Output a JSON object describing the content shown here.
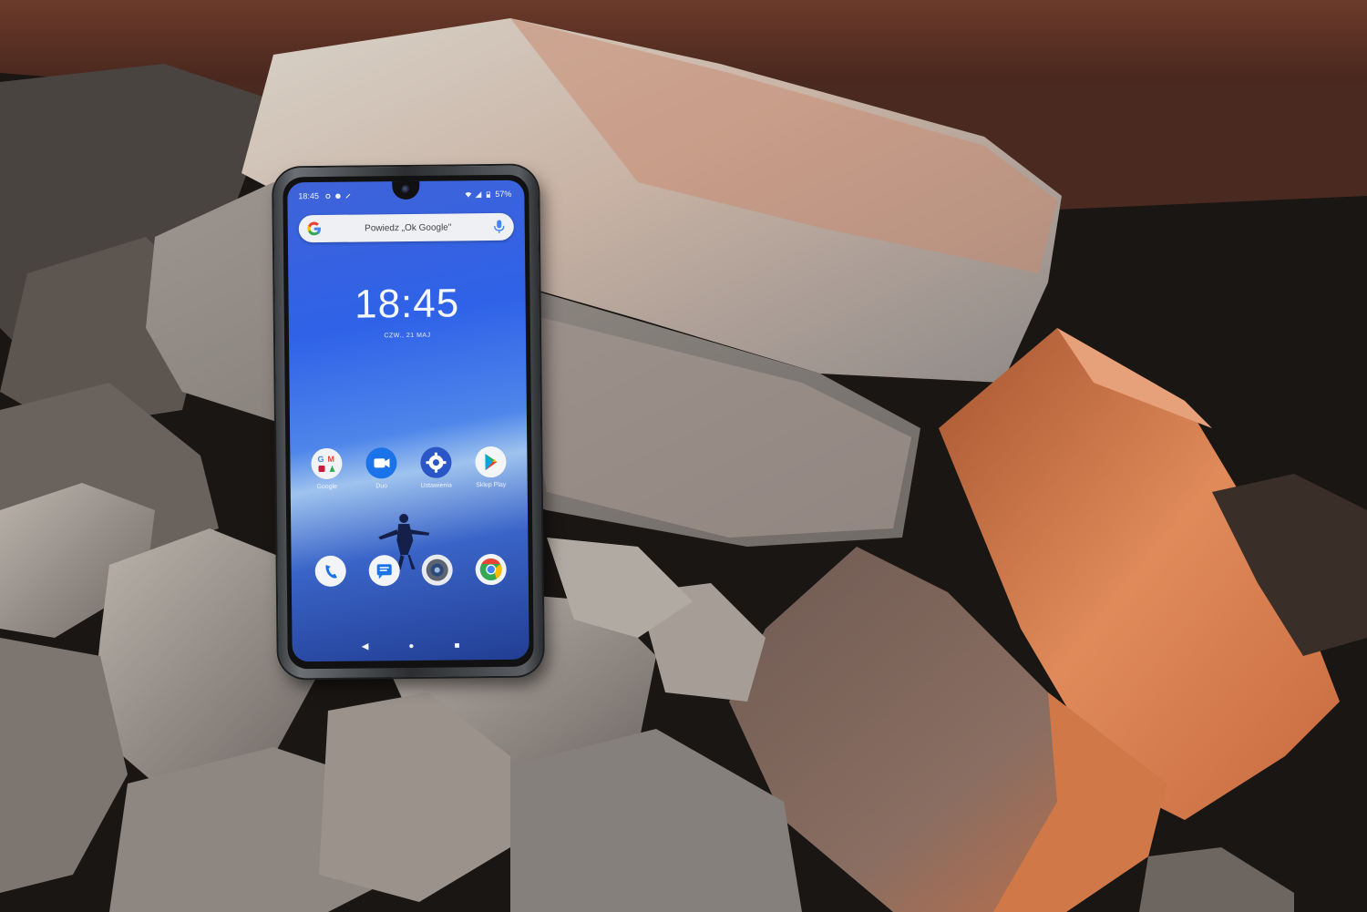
{
  "scene": {
    "description_colors": {
      "brick": "#c7653a",
      "concrete": "#a9a19a",
      "metal": "#5b2f21"
    }
  },
  "phone": {
    "status_time": "18:45",
    "battery": "57%",
    "search_placeholder": "Powiedz „Ok Google\"",
    "clock": "18:45",
    "date": "CZW., 21 MAJ",
    "apps": [
      {
        "label": "Google",
        "icon": "google-folder-icon"
      },
      {
        "label": "Duo",
        "icon": "duo-icon"
      },
      {
        "label": "Ustawienia",
        "icon": "settings-icon"
      },
      {
        "label": "Sklep Play",
        "icon": "play-store-icon"
      }
    ],
    "dock": [
      {
        "icon": "phone-icon"
      },
      {
        "icon": "messages-icon"
      },
      {
        "icon": "camera-icon"
      },
      {
        "icon": "chrome-icon"
      }
    ],
    "nav": {
      "back": "◀",
      "home": "●",
      "recents": "■"
    }
  }
}
